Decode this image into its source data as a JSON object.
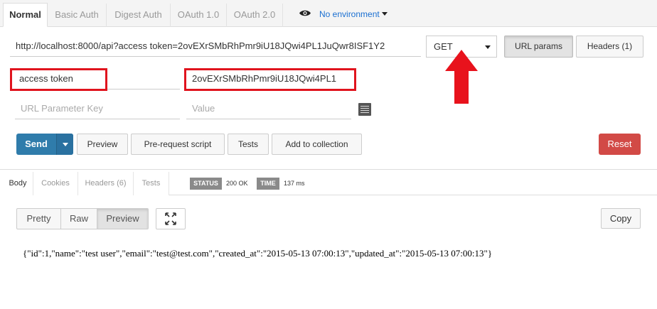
{
  "auth_tabs": [
    "Normal",
    "Basic Auth",
    "Digest Auth",
    "OAuth 1.0",
    "OAuth 2.0"
  ],
  "environment": {
    "icon": "eye-icon",
    "label": "No environment"
  },
  "request": {
    "url": "http://localhost:8000/api?access token=2ovEXrSMbRhPmr9iU18JQwi4PL1JuQwr8ISF1Y2",
    "method": "GET",
    "url_params_label": "URL params",
    "headers_label": "Headers (1)"
  },
  "params": {
    "key": "access token",
    "value": "2ovEXrSMbRhPmr9iU18JQwi4PL1",
    "key_placeholder": "URL Parameter Key",
    "value_placeholder": "Value"
  },
  "actions": {
    "send": "Send",
    "preview": "Preview",
    "prerequest": "Pre-request script",
    "tests": "Tests",
    "add_collection": "Add to collection",
    "reset": "Reset"
  },
  "response_tabs": [
    "Body",
    "Cookies",
    "Headers (6)",
    "Tests"
  ],
  "response_meta": {
    "status_label": "STATUS",
    "status_value": "200 OK",
    "time_label": "TIME",
    "time_value": "137 ms"
  },
  "view_modes": [
    "Pretty",
    "Raw",
    "Preview"
  ],
  "copy_label": "Copy",
  "response_body": "{\"id\":1,\"name\":\"test user\",\"email\":\"test@test.com\",\"created_at\":\"2015-05-13 07:00:13\",\"updated_at\":\"2015-05-13 07:00:13\"}",
  "colors": {
    "send": "#2f7cab",
    "reset": "#d24a46",
    "highlight": "#e0141e",
    "link": "#1a6fd1"
  }
}
